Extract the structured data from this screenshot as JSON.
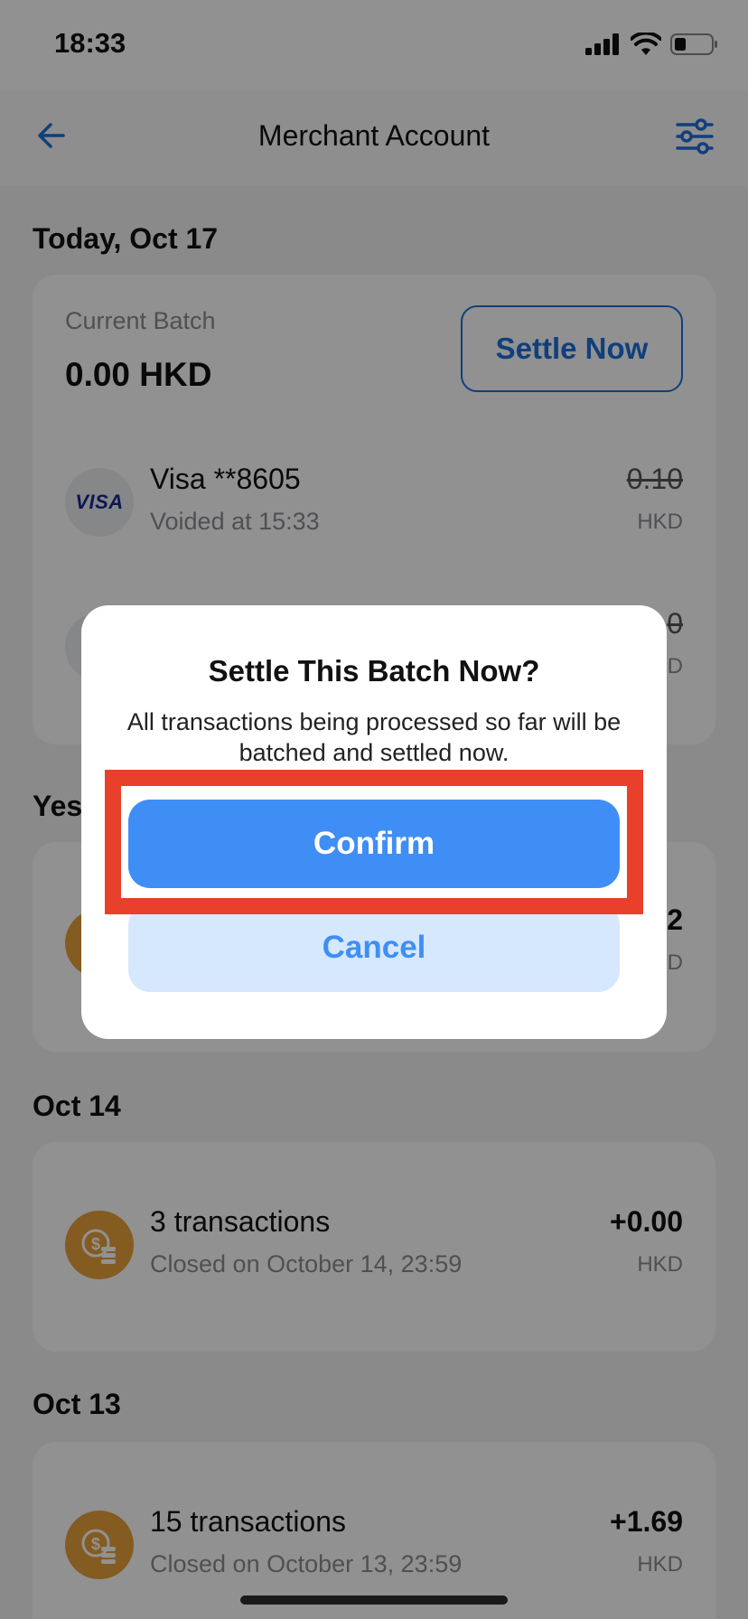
{
  "status_bar": {
    "time": "18:33"
  },
  "nav": {
    "title": "Merchant Account"
  },
  "sections": {
    "today": "Today, Oct 17",
    "yesterday": "Yes",
    "oct14": "Oct 14",
    "oct13": "Oct 13"
  },
  "current_batch": {
    "label": "Current Batch",
    "amount": "0.00 HKD",
    "settle_button": "Settle Now",
    "transactions": [
      {
        "brand": "VISA",
        "title": "Visa **8605",
        "subtitle": "Voided at 15:33",
        "amount": "0.10",
        "currency": "HKD"
      },
      {
        "amount_partial": "0",
        "currency_partial": "D"
      }
    ]
  },
  "yesterday_card": {
    "amount_partial": "2",
    "currency_partial": "D"
  },
  "oct14_card": {
    "title": "3 transactions",
    "subtitle": "Closed on October 14, 23:59",
    "amount": "+0.00",
    "currency": "HKD"
  },
  "oct13_card": {
    "title": "15 transactions",
    "subtitle": "Closed on October 13, 23:59",
    "amount": "+1.69",
    "currency": "HKD"
  },
  "dialog": {
    "title": "Settle This Batch Now?",
    "message": "All transactions being processed so far will be batched and settled now.",
    "confirm": "Confirm",
    "cancel": "Cancel"
  },
  "colors": {
    "accent": "#3f8ef5",
    "highlight": "#e8402b",
    "coin": "#e8a13a"
  },
  "icons": [
    "signal-icon",
    "wifi-icon",
    "battery-icon",
    "back-arrow-icon",
    "filter-sliders-icon",
    "coins-icon"
  ]
}
